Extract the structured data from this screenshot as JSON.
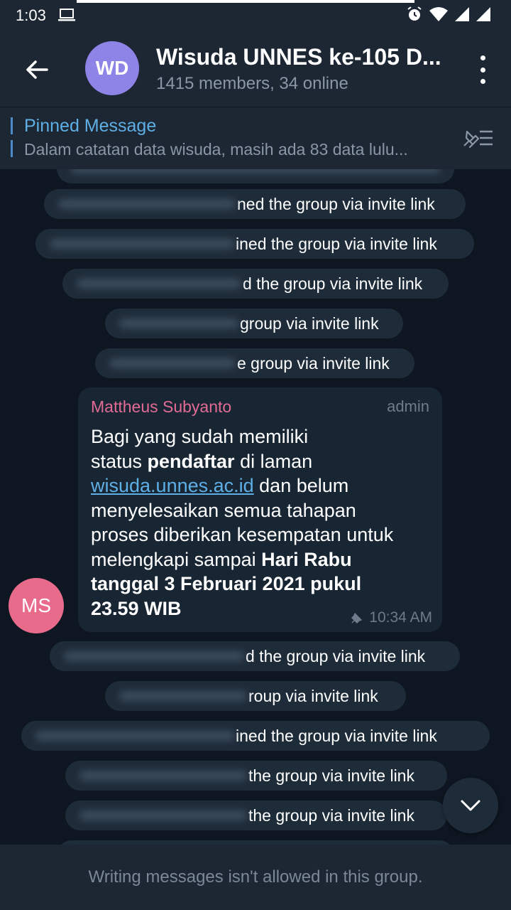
{
  "status_bar": {
    "time": "1:03",
    "icons": [
      "laptop-icon",
      "alarm-icon",
      "wifi-icon",
      "signal-icon",
      "signal-icon"
    ]
  },
  "header": {
    "avatar_initials": "WD",
    "title": "Wisuda UNNES ke-105 D...",
    "subtitle": "1415 members, 34 online"
  },
  "pinned": {
    "label": "Pinned Message",
    "preview": "Dalam catatan data wisuda, masih ada 83 data lulu..."
  },
  "service_messages_top": [
    "ned the group via invite link",
    "ined the group via invite link",
    "d the group via invite link",
    "group via invite link",
    "e group via invite link"
  ],
  "message": {
    "sender": "Mattheus Subyanto",
    "role": "admin",
    "avatar_initials": "MS",
    "line1": "Bagi yang sudah memiliki",
    "line2_pre": "status ",
    "line2_bold": "pendaftar",
    "line2_post": " di laman",
    "link": "wisuda.unnes.ac.id",
    "line3_post": " dan belum",
    "line4": "menyelesaikan semua tahapan",
    "line5": "proses diberikan kesempatan untuk",
    "line6_pre": "melengkapi sampai ",
    "line6_bold": "Hari Rabu",
    "line7_bold": "tanggal 3 Februari 2021 pukul",
    "line8_bold": "23.59 WIB",
    "time": "10:34 AM"
  },
  "service_messages_bottom": [
    "d the group via invite link",
    "roup via invite link",
    "ined the group via invite link",
    "the group via invite link",
    "the group via invite link"
  ],
  "footer": {
    "notice": "Writing messages isn't allowed in this group."
  },
  "colors": {
    "background": "#0e1621",
    "header": "#1d2733",
    "bubble": "#182533",
    "accent": "#5eafe6",
    "sender": "#e16b94"
  }
}
